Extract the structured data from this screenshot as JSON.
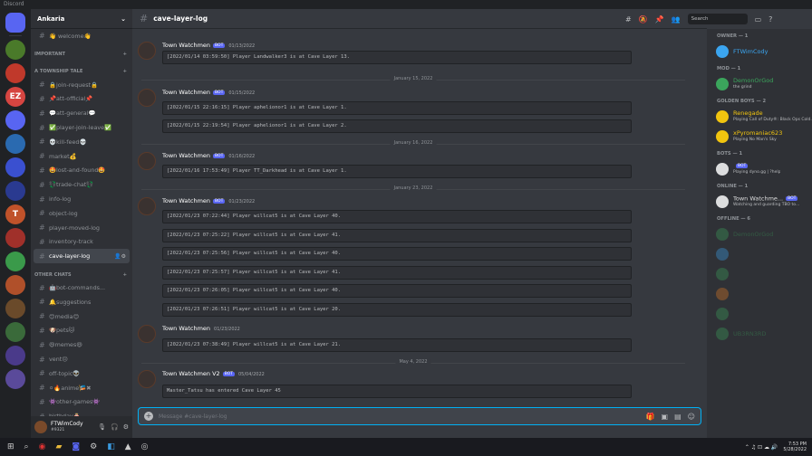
{
  "app": {
    "title": "Discord"
  },
  "guild": {
    "name": "Ankaria"
  },
  "servers": [
    {
      "label": "",
      "color": "#5865f2"
    },
    {
      "label": "",
      "color": "#4a7a2a"
    },
    {
      "label": "",
      "color": "#c0392b"
    },
    {
      "label": "EZ",
      "color": "#d64541"
    },
    {
      "label": "",
      "color": "#5865f2"
    },
    {
      "label": "",
      "color": "#2a6ab0"
    },
    {
      "label": "",
      "color": "#3a50d0"
    },
    {
      "label": "",
      "color": "#2a3a90"
    },
    {
      "label": "T",
      "color": "#c0522a"
    },
    {
      "label": "",
      "color": "#a0302a"
    },
    {
      "label": "",
      "color": "#3a9a4a"
    },
    {
      "label": "",
      "color": "#b0502a"
    },
    {
      "label": "",
      "color": "#6a4a2a"
    },
    {
      "label": "",
      "color": "#3a6a3a"
    },
    {
      "label": "",
      "color": "#4a3a8a"
    },
    {
      "label": "",
      "color": "#5a4a9a"
    }
  ],
  "channels_top": [
    {
      "name": "👋 welcome👋"
    }
  ],
  "categories": {
    "important": "IMPORTANT",
    "township": "A TOWNSHIP TALE",
    "other": "OTHER CHATS"
  },
  "township_channels": [
    {
      "name": "🔒join-request🔒"
    },
    {
      "name": "📌att-official📌"
    },
    {
      "name": "💬att-general💬"
    },
    {
      "name": "✅player-join-leave✅"
    },
    {
      "name": "💀kill-feed💀"
    },
    {
      "name": "market💰"
    },
    {
      "name": "🤩lost-and-found🤩"
    },
    {
      "name": "💱trade-chat💱"
    },
    {
      "name": "info-log"
    },
    {
      "name": "object-log"
    },
    {
      "name": "player-moved-log"
    },
    {
      "name": "inventory-track"
    },
    {
      "name": "cave-layer-log"
    }
  ],
  "other_channels": [
    {
      "name": "🤖bot-commands..."
    },
    {
      "name": "🔔suggestions"
    },
    {
      "name": "😊media😊"
    },
    {
      "name": "🐶pets🐱"
    },
    {
      "name": "😆memes😆"
    },
    {
      "name": "vent😔"
    },
    {
      "name": "off-topic👽"
    },
    {
      "name": "⚪🔥anime🎏✖"
    },
    {
      "name": "👾other-games👾"
    },
    {
      "name": "birthday🎂"
    }
  ],
  "user": {
    "name": "FTWimCody",
    "tag": "#9321"
  },
  "channel": {
    "name": "cave-layer-log"
  },
  "search": {
    "placeholder": "Search"
  },
  "composer": {
    "placeholder": "Message #cave-layer-log"
  },
  "messages": [
    {
      "author": "Town Watchmen",
      "bot": "BOT",
      "date": "01/13/2022",
      "lines": [
        "[2022/01/14 03:59:50] Player Landwalker3 is at Cave Layer 13."
      ]
    },
    {
      "divider": "January 15, 2022"
    },
    {
      "author": "Town Watchmen",
      "bot": "BOT",
      "date": "01/15/2022",
      "lines": [
        "[2022/01/15 22:16:15] Player aphelionor1 is at Cave Layer 1.",
        "[2022/01/15 22:19:54] Player aphelionor1 is at Cave Layer 2."
      ]
    },
    {
      "divider": "January 16, 2022"
    },
    {
      "author": "Town Watchmen",
      "bot": "BOT",
      "date": "01/16/2022",
      "lines": [
        "[2022/01/16 17:53:49] Player TT_Darkhead is at Cave Layer 1."
      ]
    },
    {
      "divider": "January 23, 2022"
    },
    {
      "author": "Town Watchmen",
      "bot": "BOT",
      "date": "01/23/2022",
      "lines": [
        "[2022/01/23 07:22:44] Player willcat5 is at Cave Layer 40.",
        "[2022/01/23 07:25:22] Player willcat5 is at Cave Layer 41.",
        "[2022/01/23 07:25:56] Player willcat5 is at Cave Layer 40.",
        "[2022/01/23 07:25:57] Player willcat5 is at Cave Layer 41.",
        "[2022/01/23 07:26:05] Player willcat5 is at Cave Layer 40.",
        "[2022/01/23 07:26:51] Player willcat5 is at Cave Layer 20."
      ]
    },
    {
      "author": "Town Watchmen",
      "bot": "",
      "date": "01/23/2022",
      "lines": [
        "[2022/01/23 07:38:49] Player willcat5 is at Cave Layer 21."
      ]
    },
    {
      "divider": "May 4, 2022"
    },
    {
      "author": "Town Watchmen V2",
      "bot": "BOT",
      "date": "05/04/2022",
      "lines": [
        "Master_Tatsu has entered Cave Layer 45"
      ]
    }
  ],
  "members": {
    "owner_header": "OWNER — 1",
    "owner": [
      {
        "name": "FTWimCody",
        "activity": "",
        "color": "#3ba5f0"
      }
    ],
    "mod_header": "MOD — 1",
    "mod": [
      {
        "name": "DemonOrGod",
        "activity": "the grind",
        "color": "#3ba55c"
      }
    ],
    "golden_header": "GOLDEN BOYS — 2",
    "golden": [
      {
        "name": "Renegade",
        "activity": "Playing Call of Duty®: Black Ops Cold...",
        "color": "#f1c40f"
      },
      {
        "name": "xPyromaniac623",
        "activity": "Playing No Man's Sky",
        "color": "#f1c40f"
      }
    ],
    "bots_header": "BOTS — 1",
    "bots": [
      {
        "name": "",
        "badge": "BOT",
        "activity": "Playing dyno.gg | ?help",
        "color": "#dcddde"
      }
    ],
    "online_header": "ONLINE — 1",
    "online": [
      {
        "name": "Town Watchme...",
        "badge": "BOT",
        "activity": "Watching and guarding TBO to...",
        "color": "#dcddde"
      }
    ],
    "offline_header": "OFFLINE — 6",
    "offline": [
      {
        "name": "DemonOrGod",
        "color": "#3ba55c"
      },
      {
        "name": "",
        "color": "#3ba5f0"
      },
      {
        "name": "",
        "color": "#3ba55c"
      },
      {
        "name": "",
        "color": "#e67e22"
      },
      {
        "name": "",
        "color": "#3ba55c"
      },
      {
        "name": "UB3RN3RD",
        "color": "#3ba55c"
      }
    ]
  },
  "taskbar": {
    "time": "7:53 PM",
    "date": "5/28/2022"
  }
}
